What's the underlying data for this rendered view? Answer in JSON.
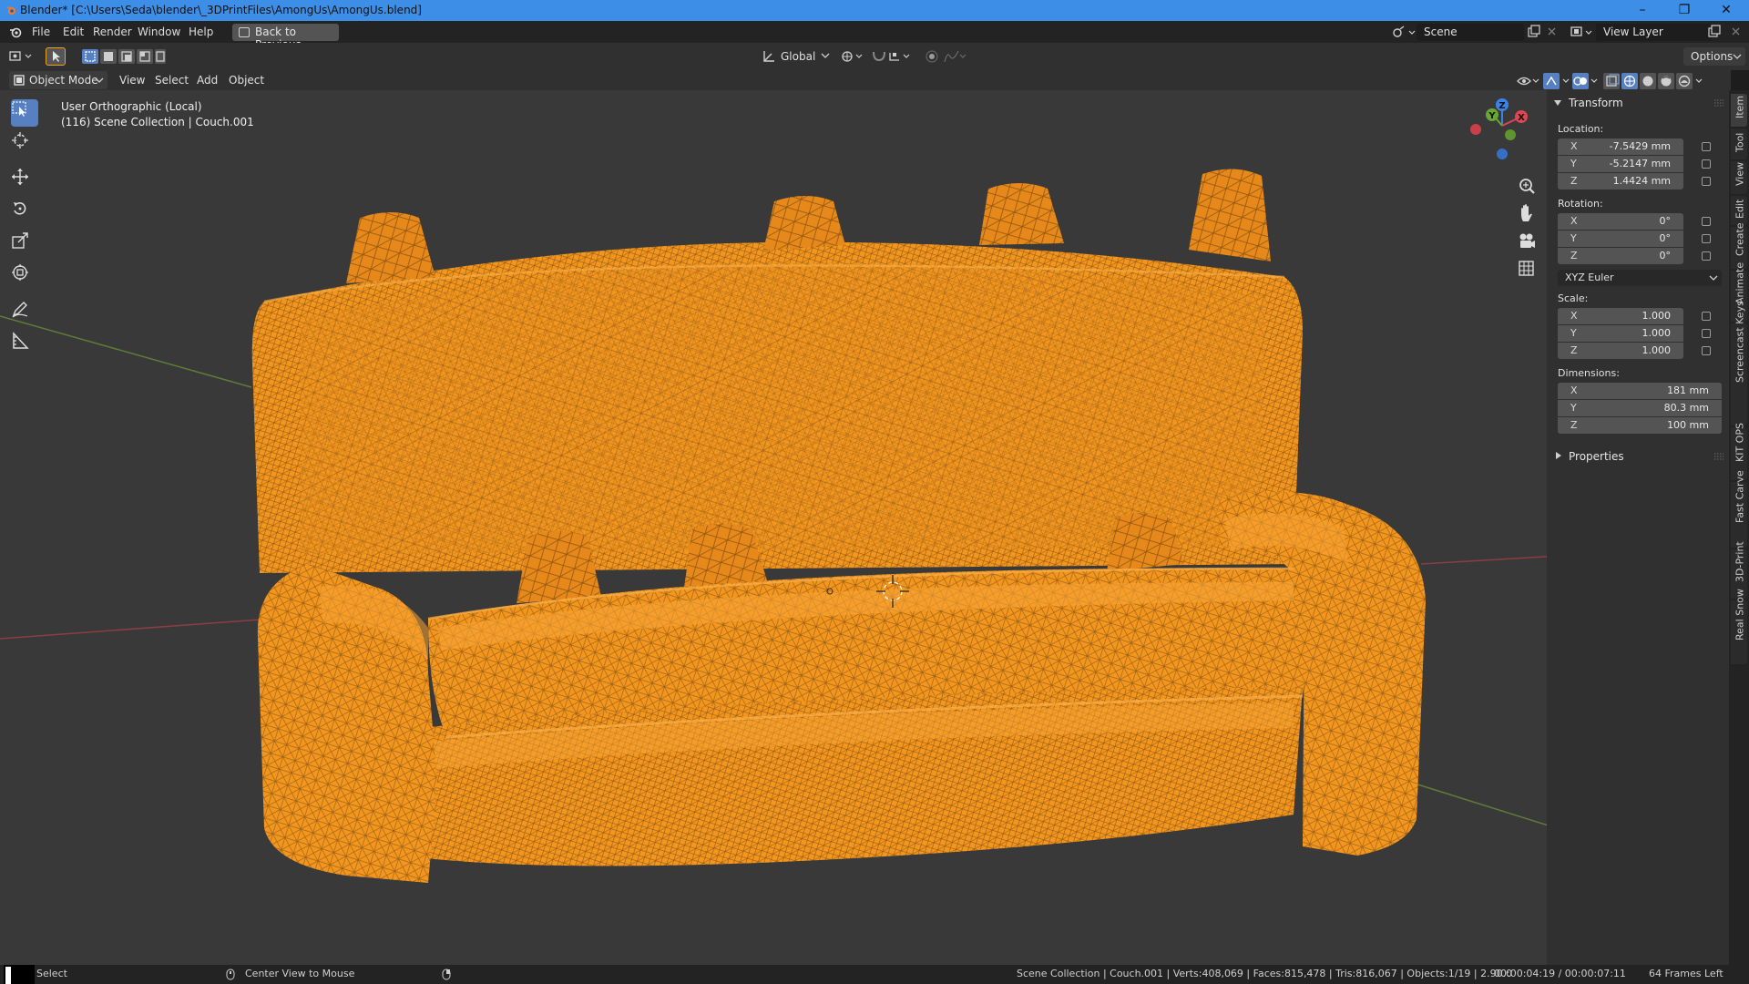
{
  "window": {
    "title": "Blender* [C:\\Users\\Seda\\blender\\_3DPrintFiles\\AmongUs\\AmongUs.blend]",
    "minimize_glyph": "–",
    "maximize_glyph": "❐",
    "close_glyph": "✕"
  },
  "topbar": {
    "menus": [
      "File",
      "Edit",
      "Render",
      "Window",
      "Help"
    ],
    "back_button": "Back to Previous",
    "scene_label": "Scene",
    "view_layer_label": "View Layer"
  },
  "viewport_header": {
    "transform_orientation": "Global",
    "options_label": "Options",
    "mode": "Object Mode",
    "menus": [
      "View",
      "Select",
      "Add",
      "Object"
    ]
  },
  "viewport": {
    "view_name": "User Orthographic (Local)",
    "collection_info": "(116) Scene Collection | Couch.001",
    "gizmo_axes": [
      "Z",
      "Y",
      "X"
    ],
    "wire_color": "#f3961e"
  },
  "toolbar": {
    "tools": [
      "select-box",
      "cursor",
      "move",
      "rotate",
      "scale",
      "transform",
      "annotate",
      "measure"
    ]
  },
  "sidebar": {
    "transform_header": "Transform",
    "location_label": "Location:",
    "location": [
      {
        "axis": "X",
        "value": "-7.5429 mm"
      },
      {
        "axis": "Y",
        "value": "-5.2147 mm"
      },
      {
        "axis": "Z",
        "value": "1.4424 mm"
      }
    ],
    "rotation_label": "Rotation:",
    "rotation": [
      {
        "axis": "X",
        "value": "0°"
      },
      {
        "axis": "Y",
        "value": "0°"
      },
      {
        "axis": "Z",
        "value": "0°"
      }
    ],
    "rotation_mode": "XYZ Euler",
    "scale_label": "Scale:",
    "scale": [
      {
        "axis": "X",
        "value": "1.000"
      },
      {
        "axis": "Y",
        "value": "1.000"
      },
      {
        "axis": "Z",
        "value": "1.000"
      }
    ],
    "dimensions_label": "Dimensions:",
    "dimensions": [
      {
        "axis": "X",
        "value": "181 mm"
      },
      {
        "axis": "Y",
        "value": "80.3 mm"
      },
      {
        "axis": "Z",
        "value": "100 mm"
      }
    ],
    "properties_header": "Properties"
  },
  "tabs": [
    "Item",
    "Tool",
    "View",
    "Edit",
    "Create",
    "Animate",
    "Screencast Keys",
    "KIT OPS",
    "Fast Carve",
    "3D-Print",
    "Real Snow"
  ],
  "statusbar": {
    "left_action": "Select",
    "middle_action": "Center View to Mouse",
    "stats": "Scene Collection | Couch.001 | Verts:408,069 | Faces:815,478 | Tris:816,067 | Objects:1/19 | 2.90.0",
    "time": "00:00:04:19 / 00:00:07:11",
    "frames_left": "64 Frames Left"
  }
}
